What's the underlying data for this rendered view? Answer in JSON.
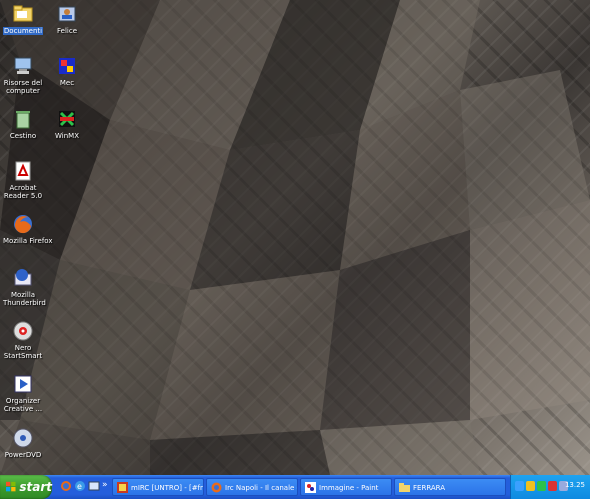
{
  "desktop_icons": [
    {
      "name": "documents",
      "label": "Documenti",
      "selected": true
    },
    {
      "name": "felice",
      "label": "Felice"
    },
    {
      "name": "network",
      "label": "Risorse del computer"
    },
    {
      "name": "mec",
      "label": "Mec"
    },
    {
      "name": "recycle",
      "label": "Cestino"
    },
    {
      "name": "winmx",
      "label": "WinMX"
    },
    {
      "name": "acrobat",
      "label": "Acrobat Reader 5.0"
    },
    {
      "name": "firefox",
      "label": "Mozilla Firefox"
    },
    {
      "name": "thunderbird",
      "label": "Mozilla Thunderbird"
    },
    {
      "name": "nero",
      "label": "Nero StartSmart"
    },
    {
      "name": "organizer",
      "label": "Organizer Creative ..."
    },
    {
      "name": "powerdvd",
      "label": "PowerDVD"
    }
  ],
  "taskbar": {
    "start_label": "start",
    "tasks": [
      {
        "label": "mIRC [UNTRO] - [#fn..."
      },
      {
        "label": "Irc Napoli - Il canale c..."
      },
      {
        "label": "Immagine - Paint"
      },
      {
        "label": "FERRARA"
      }
    ],
    "clock": "13.25"
  }
}
